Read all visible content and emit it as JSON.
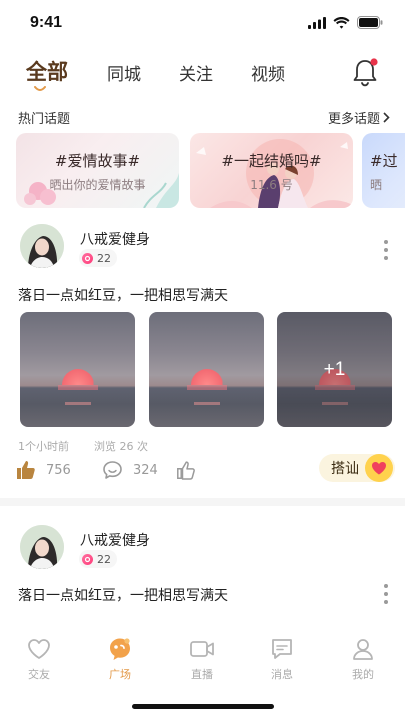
{
  "status_bar": {
    "time": "9:41"
  },
  "tabs": [
    {
      "label": "全部",
      "active": true
    },
    {
      "label": "同城",
      "active": false
    },
    {
      "label": "关注",
      "active": false
    },
    {
      "label": "视频",
      "active": false
    }
  ],
  "hot_topics": {
    "title": "热门话题",
    "more": "更多话题",
    "items": [
      {
        "title": "#爱情故事#",
        "subtitle": "晒出你的爱情故事"
      },
      {
        "title": "#一起结婚吗#",
        "subtitle": "11.6 号"
      },
      {
        "title": "#过",
        "subtitle": "晒"
      }
    ]
  },
  "posts": [
    {
      "username": "八戒爱健身",
      "level": "22",
      "text": "落日一点如红豆，一把相思写满天",
      "extra_photos": "+1",
      "time": "1个小时前",
      "views": "浏览 26 次",
      "likes": "756",
      "comments": "324",
      "flirt_label": "搭讪"
    },
    {
      "username": "八戒爱健身",
      "level": "22",
      "text": "落日一点如红豆，一把相思写满天"
    }
  ],
  "bottom_nav": [
    {
      "label": "交友",
      "icon": "heart-icon",
      "active": false
    },
    {
      "label": "广场",
      "icon": "plaza-icon",
      "active": true
    },
    {
      "label": "直播",
      "icon": "video-camera-icon",
      "active": false
    },
    {
      "label": "消息",
      "icon": "message-icon",
      "active": false
    },
    {
      "label": "我的",
      "icon": "user-icon",
      "active": false
    }
  ],
  "colors": {
    "accent": "#e39a4a",
    "active_tab": "#5a3a1e",
    "notify_dot": "#e8334a",
    "flirt_bg": "#fbf4df"
  }
}
